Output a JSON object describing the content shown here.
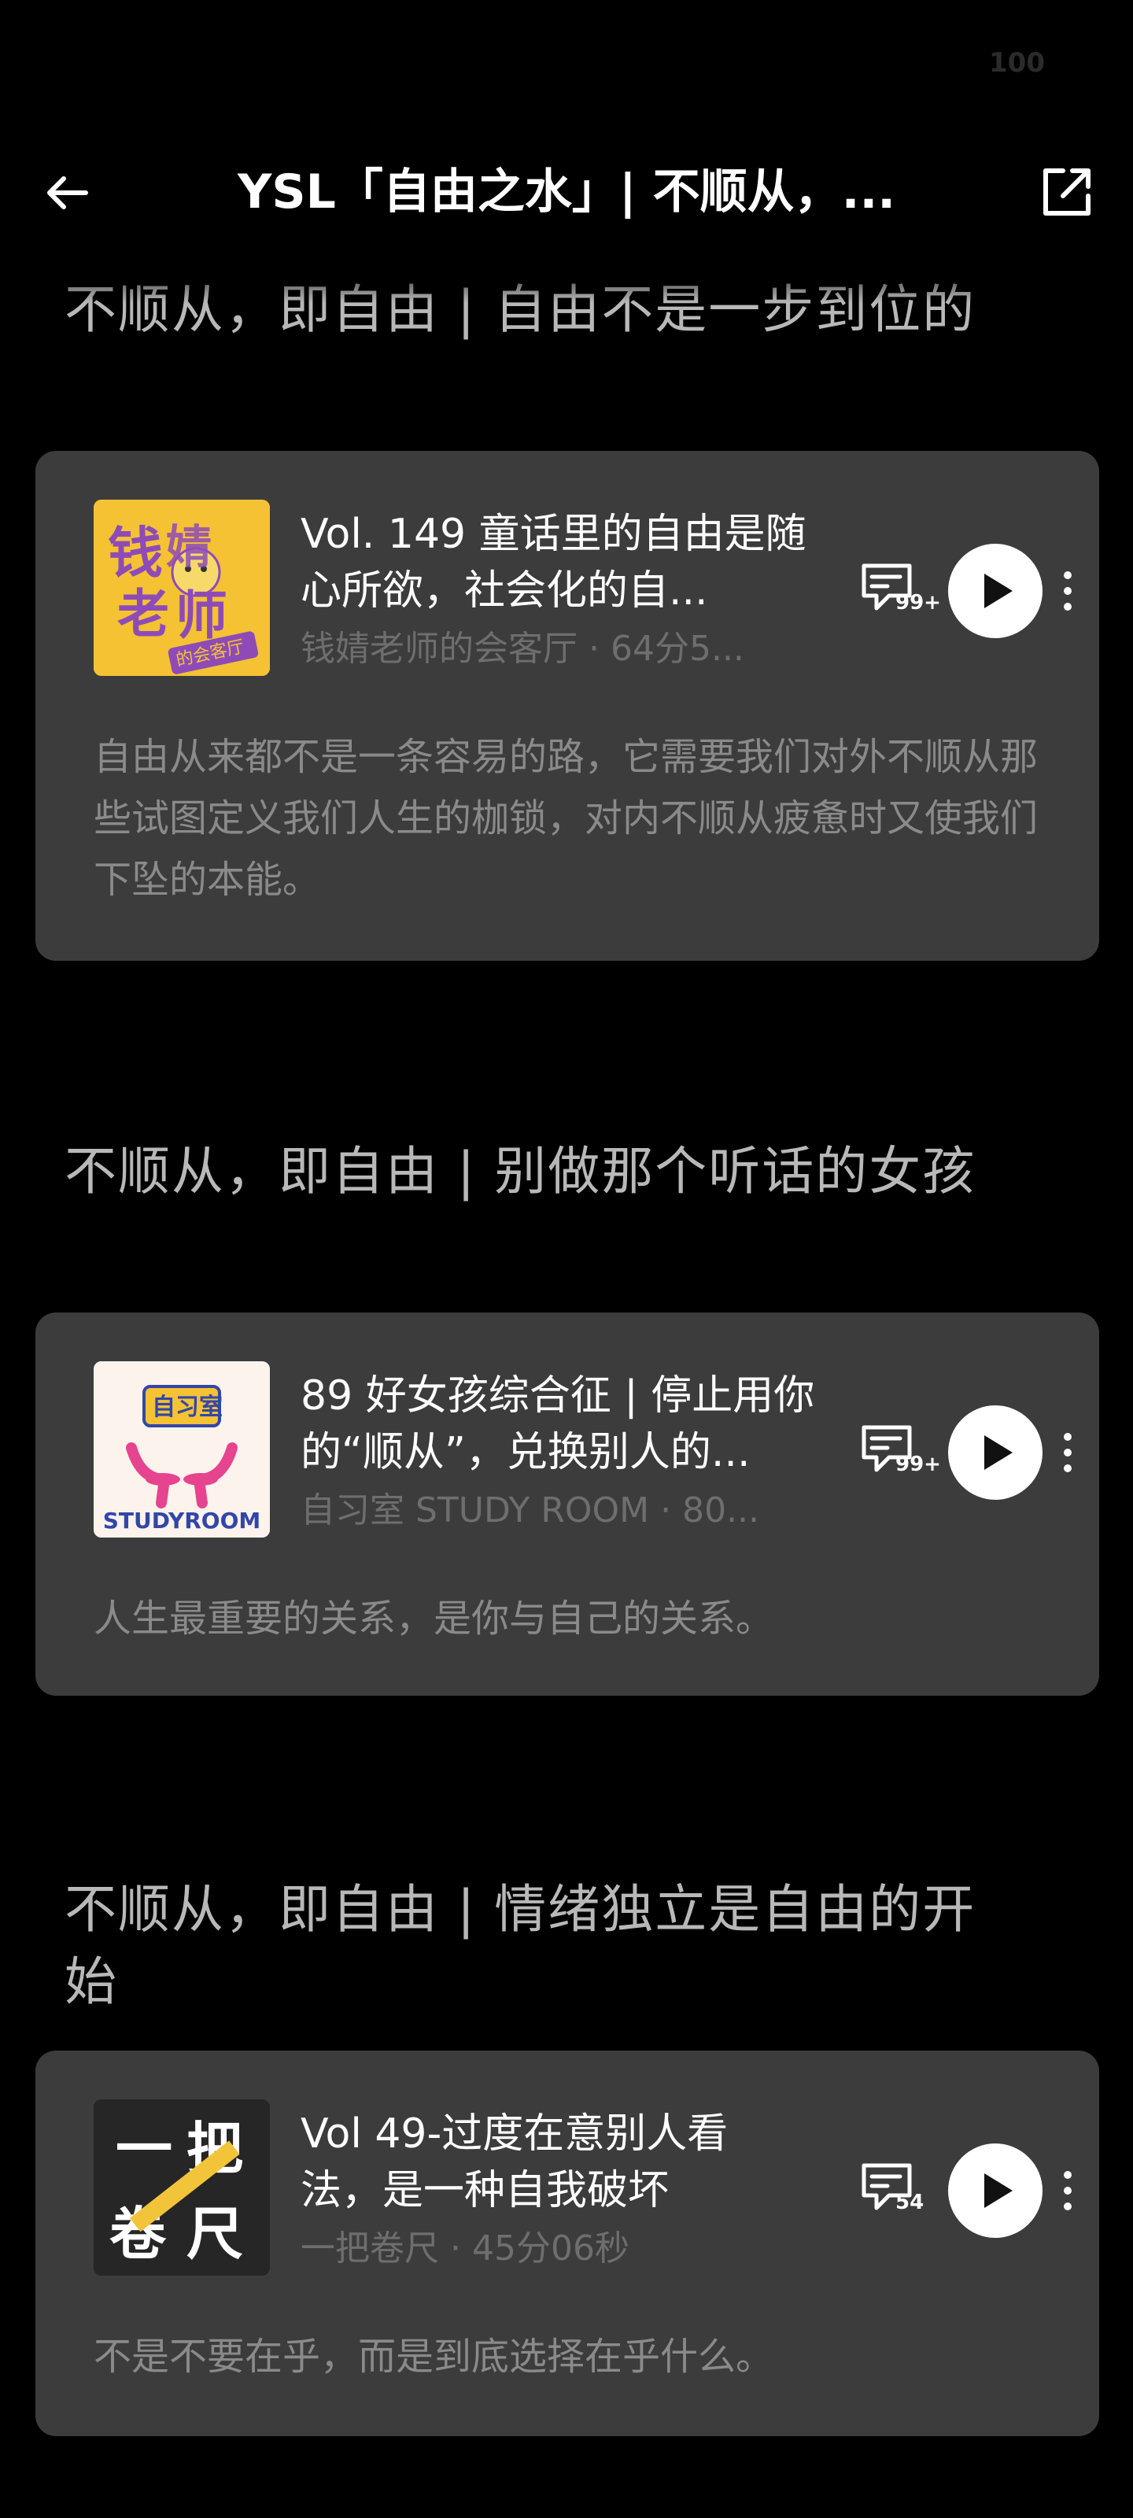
{
  "status_bar": {
    "battery": "100"
  },
  "header": {
    "title": "YSL「自由之水」| 不顺从，...",
    "back_icon": "arrow-left-icon",
    "share_icon": "share-external-icon"
  },
  "sections": [
    {
      "title": "不顺从，即自由 | 自由不是一步到位的",
      "episode": {
        "cover_text_main": "钱婧老师",
        "cover_text_sub": "的会客厅",
        "title": "Vol. 149 童话里的自由是随心所欲，社会化的自...",
        "meta": "钱婧老师的会客厅 · 64分5...",
        "comment_count": "99+",
        "description": "自由从来都不是一条容易的路，它需要我们对外不顺从那些试图定义我们人生的枷锁，对内不顺从疲惫时又使我们下坠的本能。"
      }
    },
    {
      "title": "不顺从，即自由 | 别做那个听话的女孩",
      "episode": {
        "cover_text_main": "自习室",
        "cover_text_sub": "STUDYROOM",
        "title": "89 好女孩综合征 | 停止用你的“顺从”，兑换别人的...",
        "meta": "自习室 STUDY ROOM · 80...",
        "comment_count": "99+",
        "description": "人生最重要的关系，是你与自己的关系。"
      }
    },
    {
      "title": "不顺从，即自由 | 情绪独立是自由的开始",
      "episode": {
        "cover_text_main": "一把卷尺",
        "cover_text_sub": "",
        "title": "Vol 49-过度在意别人看法，是一种自我破坏",
        "meta": "一把卷尺 · 45分06秒",
        "comment_count": "54",
        "description": "不是不要在乎，而是到底选择在乎什么。"
      }
    }
  ],
  "colors": {
    "background": "#000000",
    "card": "#3c3c3c",
    "section_title": "#b8b8b8",
    "meta": "#6e6e6e",
    "description": "#8a8a8a",
    "cover1_bg": "#f4c233",
    "cover1_text": "#8e4bb8",
    "cover2_accent": "#e6448f",
    "cover2_text": "#3346a8",
    "cover3_bg": "#262626",
    "cover3_ruler": "#f2c43a"
  }
}
